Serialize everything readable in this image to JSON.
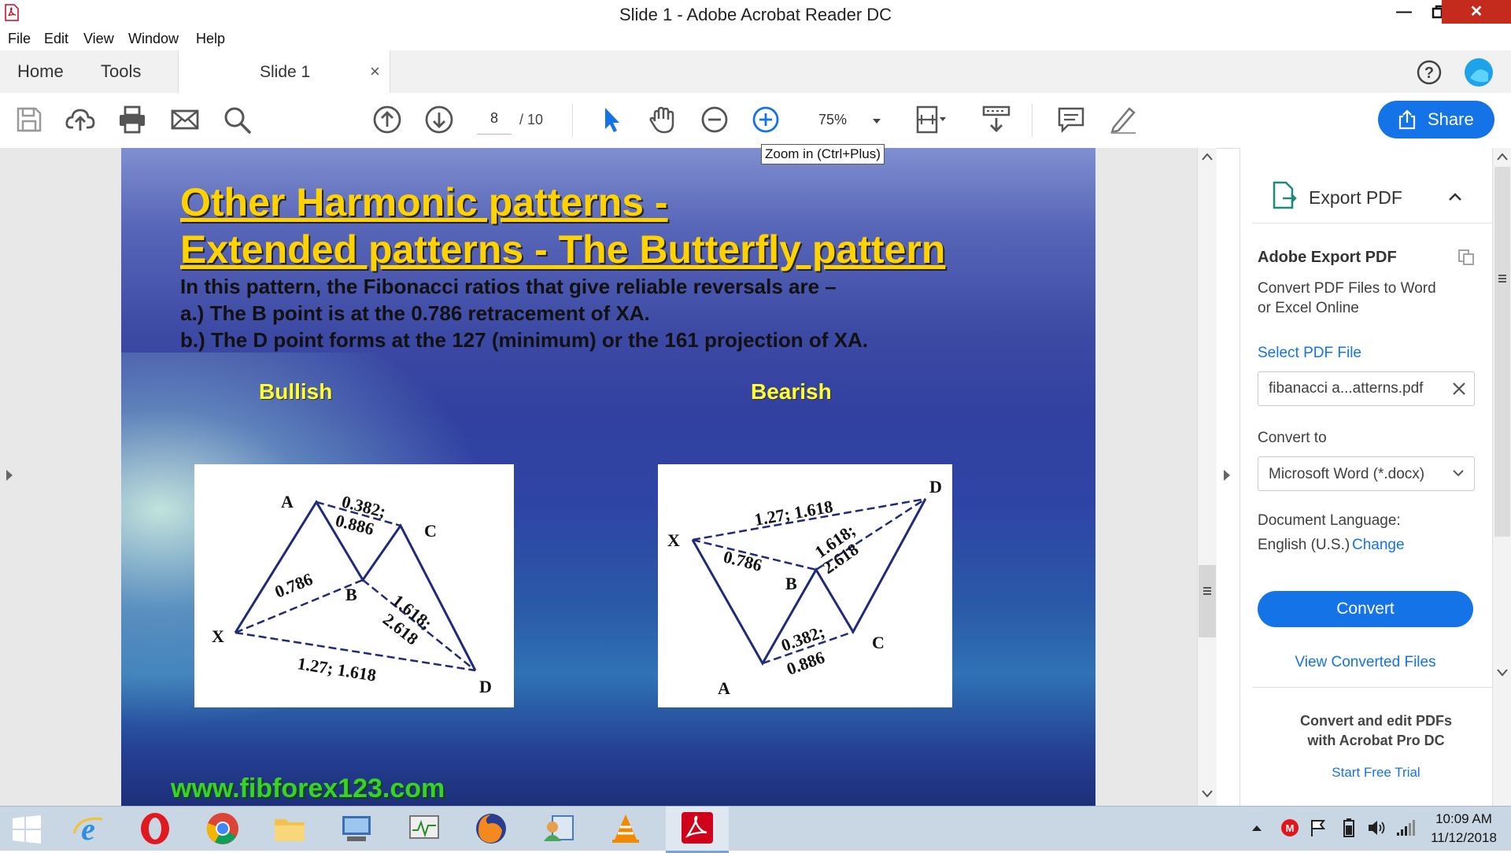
{
  "window": {
    "title": "Slide 1 - Adobe Acrobat Reader DC",
    "minimize_glyph": "—",
    "restore_glyph": "❐",
    "close_glyph": "✕"
  },
  "menu": [
    "File",
    "Edit",
    "View",
    "Window",
    "Help"
  ],
  "tabs": {
    "home": "Home",
    "tools": "Tools",
    "document": "Slide 1",
    "close_glyph": "×"
  },
  "toolbar": {
    "current_page": "8",
    "page_total": "/ 10",
    "zoom": "75%",
    "share_label": "Share",
    "tooltip": "Zoom in (Ctrl+Plus)"
  },
  "slide": {
    "title_line1": "Other Harmonic patterns -",
    "title_line2": "Extended patterns - The Butterfly pattern",
    "body_line1": "In this pattern, the Fibonacci ratios that give reliable reversals are –",
    "body_line2": "a.) The B point is at the 0.786 retracement of XA.",
    "body_line3": "b.) The D point forms at the 127 (minimum) or the 161 projection of XA.",
    "bullish_label": "Bullish",
    "bearish_label": "Bearish",
    "website": "www.fibforex123.com",
    "bullish_diagram": {
      "point_a": "A",
      "point_b": "B",
      "point_c": "C",
      "point_d": "D",
      "point_x": "X",
      "ratio_ac_1": "0.382;",
      "ratio_ac_2": "0.886",
      "ratio_xb": "0.786",
      "ratio_bd_1": "1.618;",
      "ratio_bd_2": "2.618",
      "ratio_xd": "1.27; 1.618"
    },
    "bearish_diagram": {
      "point_a": "A",
      "point_b": "B",
      "point_c": "C",
      "point_d": "D",
      "point_x": "X",
      "ratio_xd": "1.27; 1.618",
      "ratio_xb": "0.786",
      "ratio_bd_1": "1.618;",
      "ratio_bd_2": "2.618",
      "ratio_ac_1": "0.382;",
      "ratio_ac_2": "0.886"
    }
  },
  "right_panel": {
    "header": "Export PDF",
    "section_title": "Adobe Export PDF",
    "description_line1": "Convert PDF Files to Word",
    "description_line2": "or Excel Online",
    "select_file_link": "Select PDF File",
    "selected_file": "fibanacci a...atterns.pdf",
    "convert_to_label": "Convert to",
    "convert_to_value": "Microsoft Word (*.docx)",
    "doc_language_label": "Document Language:",
    "doc_language_value": "English (U.S.)",
    "change_link": "Change",
    "convert_button": "Convert",
    "view_converted": "View Converted Files",
    "promo_line1": "Convert and edit PDFs",
    "promo_line2": "with Acrobat Pro DC",
    "trial_link": "Start Free Trial"
  },
  "taskbar": {
    "time": "10:09 AM",
    "date": "11/12/2018"
  },
  "colors": {
    "accent": "#1473e6",
    "slide_title": "#ffd200",
    "slide_label": "#ffff33",
    "website": "#39d22a",
    "close_button": "#c42b1c"
  }
}
